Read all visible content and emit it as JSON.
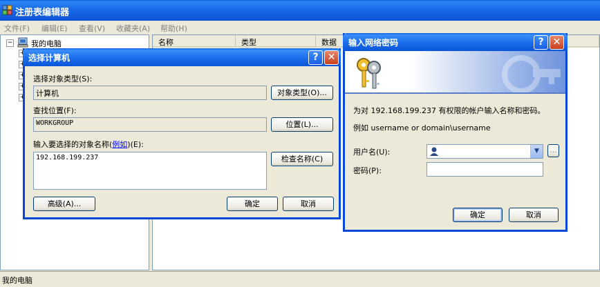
{
  "regedit": {
    "title": "注册表编辑器",
    "menu": [
      "文件(F)",
      "编辑(E)",
      "查看(V)",
      "收藏夹(A)",
      "帮助(H)"
    ],
    "tree_root": "我的电脑",
    "columns": [
      "名称",
      "类型",
      "数据"
    ],
    "status": "我的电脑"
  },
  "select_computer": {
    "title": "选择计算机",
    "object_type_label": "选择对象类型(S):",
    "object_type_value": "计算机",
    "object_type_button": "对象类型(O)...",
    "location_label": "查找位置(F):",
    "location_value": "WORKGROUP",
    "location_button": "位置(L)...",
    "names_label": "输入要选择的对象名称",
    "names_link": "例如",
    "names_label_suffix": "(E):",
    "names_value": "192.168.199.237",
    "check_names_button": "检查名称(C)",
    "advanced_button": "高级(A)...",
    "ok_button": "确定",
    "cancel_button": "取消"
  },
  "password_dialog": {
    "title": "输入网络密码",
    "message": "为对 192.168.199.237 有权限的帐户输入名称和密码。",
    "example": "例如 username or domain\\username",
    "username_label": "用户名(U):",
    "username_value": "",
    "password_label": "密码(P):",
    "password_value": "",
    "browse_button": "...",
    "ok_button": "确定",
    "cancel_button": "取消"
  },
  "colors": {
    "xp_blue": "#0a5fe0",
    "dialog_bg": "#ece9d8",
    "close_red": "#c8401c"
  }
}
